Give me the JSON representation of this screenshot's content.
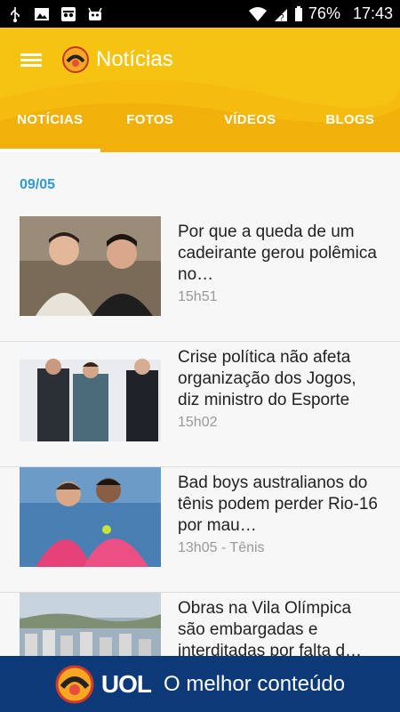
{
  "status_bar": {
    "battery": "76%",
    "time": "17:43",
    "icons": [
      "usb-icon",
      "image-icon",
      "incognito-icon",
      "android-icon",
      "wifi-icon",
      "signal-icon",
      "battery-icon"
    ]
  },
  "app_bar": {
    "title": "Notícias",
    "menu_icon": "menu-icon",
    "logo_icon": "uol-logo-icon"
  },
  "tabs": [
    {
      "label": "NOTÍCIAS",
      "active": true
    },
    {
      "label": "FOTOS",
      "active": false
    },
    {
      "label": "VÍDEOS",
      "active": false
    },
    {
      "label": "BLOGS",
      "active": false
    }
  ],
  "feed": {
    "date": "09/05",
    "items": [
      {
        "headline": "Por que a queda de um cadeirante gerou polêmica no…",
        "meta": "15h51"
      },
      {
        "headline": "Crise política não afeta organização dos Jogos, diz ministro do Esporte",
        "meta": "15h02"
      },
      {
        "headline": "Bad boys australianos do tênis podem perder Rio-16 por mau…",
        "meta": "13h05 - Tênis"
      },
      {
        "headline": "Obras na Vila Olímpica são embargadas e interditadas por falta d…",
        "meta": ""
      }
    ]
  },
  "footer": {
    "brand": "UOL",
    "tagline": "O melhor conteúdo"
  },
  "colors": {
    "app_bar": "#f7c313",
    "date": "#2e9bd6",
    "footer": "#0c3a78"
  }
}
